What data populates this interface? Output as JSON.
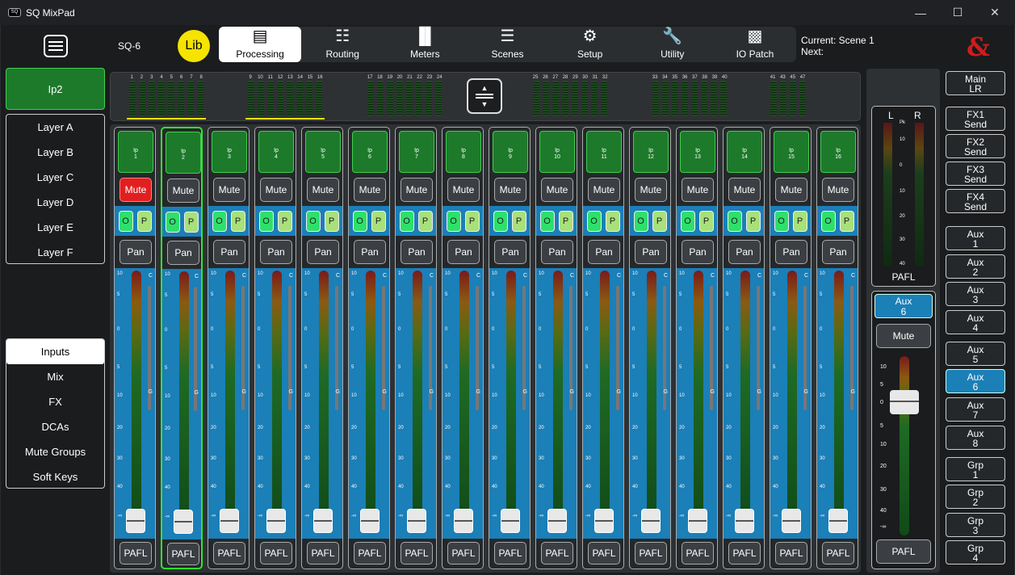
{
  "window": {
    "title": "SQ MixPad",
    "icon": "sq-app-icon",
    "controls": [
      "minimize-icon",
      "maximize-icon",
      "close-icon"
    ]
  },
  "header": {
    "menu_icon": "hamburger-menu-icon",
    "model": "SQ-6",
    "lib": "Lib",
    "scene_current": "Current: Scene 1",
    "scene_next": "Next:",
    "logo": "&"
  },
  "tabs": [
    {
      "label": "Processing",
      "icon": "processing-icon",
      "active": true
    },
    {
      "label": "Routing",
      "icon": "routing-icon"
    },
    {
      "label": "Meters",
      "icon": "meters-icon"
    },
    {
      "label": "Scenes",
      "icon": "scenes-icon"
    },
    {
      "label": "Setup",
      "icon": "gear-icon"
    },
    {
      "label": "Utility",
      "icon": "wrench-icon"
    },
    {
      "label": "IO Patch",
      "icon": "io-patch-icon"
    }
  ],
  "selected_layer_input": "Ip2",
  "layers": [
    "Layer A",
    "Layer B",
    "Layer C",
    "Layer D",
    "Layer E",
    "Layer F"
  ],
  "strip_types": [
    {
      "label": "Inputs",
      "selected": true
    },
    {
      "label": "Mix"
    },
    {
      "label": "FX"
    },
    {
      "label": "DCAs"
    },
    {
      "label": "Mute Groups"
    },
    {
      "label": "Soft Keys"
    }
  ],
  "meter_groups": [
    [
      "1",
      "2",
      "3",
      "4",
      "5",
      "6",
      "7",
      "8"
    ],
    [
      "9",
      "10",
      "11",
      "12",
      "13",
      "14",
      "15",
      "16"
    ],
    [
      "17",
      "18",
      "19",
      "20",
      "21",
      "22",
      "23",
      "24"
    ],
    [
      "25",
      "26",
      "27",
      "28",
      "29",
      "30",
      "31",
      "32"
    ],
    [
      "33",
      "34",
      "35",
      "36",
      "37",
      "38",
      "39",
      "40"
    ],
    [
      "41",
      "43",
      "45",
      "47"
    ]
  ],
  "fader_scale": [
    "10",
    "5",
    "0",
    "5",
    "10",
    "20",
    "30",
    "40",
    "-∞"
  ],
  "channels": [
    {
      "name": "Ip\n1",
      "mute": "Mute",
      "mute_on": true
    },
    {
      "name": "Ip\n2",
      "mute": "Mute",
      "selected": true
    },
    {
      "name": "Ip\n3",
      "mute": "Mute"
    },
    {
      "name": "Ip\n4",
      "mute": "Mute"
    },
    {
      "name": "Ip\n5",
      "mute": "Mute"
    },
    {
      "name": "Ip\n6",
      "mute": "Mute"
    },
    {
      "name": "Ip\n7",
      "mute": "Mute"
    },
    {
      "name": "Ip\n8",
      "mute": "Mute"
    },
    {
      "name": "Ip\n9",
      "mute": "Mute"
    },
    {
      "name": "Ip\n10",
      "mute": "Mute"
    },
    {
      "name": "Ip\n11",
      "mute": "Mute"
    },
    {
      "name": "Ip\n12",
      "mute": "Mute"
    },
    {
      "name": "Ip\n13",
      "mute": "Mute"
    },
    {
      "name": "Ip\n14",
      "mute": "Mute"
    },
    {
      "name": "Ip\n15",
      "mute": "Mute"
    },
    {
      "name": "Ip\n16",
      "mute": "Mute"
    }
  ],
  "strip_labels": {
    "o": "O",
    "p": "P",
    "pan": "Pan",
    "pafl": "PAFL",
    "c": "C",
    "g": "G"
  },
  "pafl_meter": {
    "l": "L",
    "r": "R",
    "pk": "Pk",
    "scale": [
      "10",
      "0",
      "10",
      "20",
      "30",
      "40"
    ],
    "label": "PAFL"
  },
  "mix_strip": {
    "name": "Aux\n6",
    "mute": "Mute",
    "pafl": "PAFL",
    "scale": [
      "10",
      "5",
      "0",
      "5",
      "10",
      "20",
      "30",
      "40",
      "-∞"
    ]
  },
  "right_buttons": [
    {
      "label": "Main\nLR"
    },
    {
      "label": "FX1\nSend"
    },
    {
      "label": "FX2\nSend"
    },
    {
      "label": "FX3\nSend"
    },
    {
      "label": "FX4\nSend"
    },
    {
      "label": "Aux\n1"
    },
    {
      "label": "Aux\n2"
    },
    {
      "label": "Aux\n3"
    },
    {
      "label": "Aux\n4"
    },
    {
      "label": "Aux\n5"
    },
    {
      "label": "Aux\n6",
      "selected": true
    },
    {
      "label": "Aux\n7"
    },
    {
      "label": "Aux\n8"
    },
    {
      "label": "Grp\n1"
    },
    {
      "label": "Grp\n2"
    },
    {
      "label": "Grp\n3"
    },
    {
      "label": "Grp\n4"
    }
  ]
}
